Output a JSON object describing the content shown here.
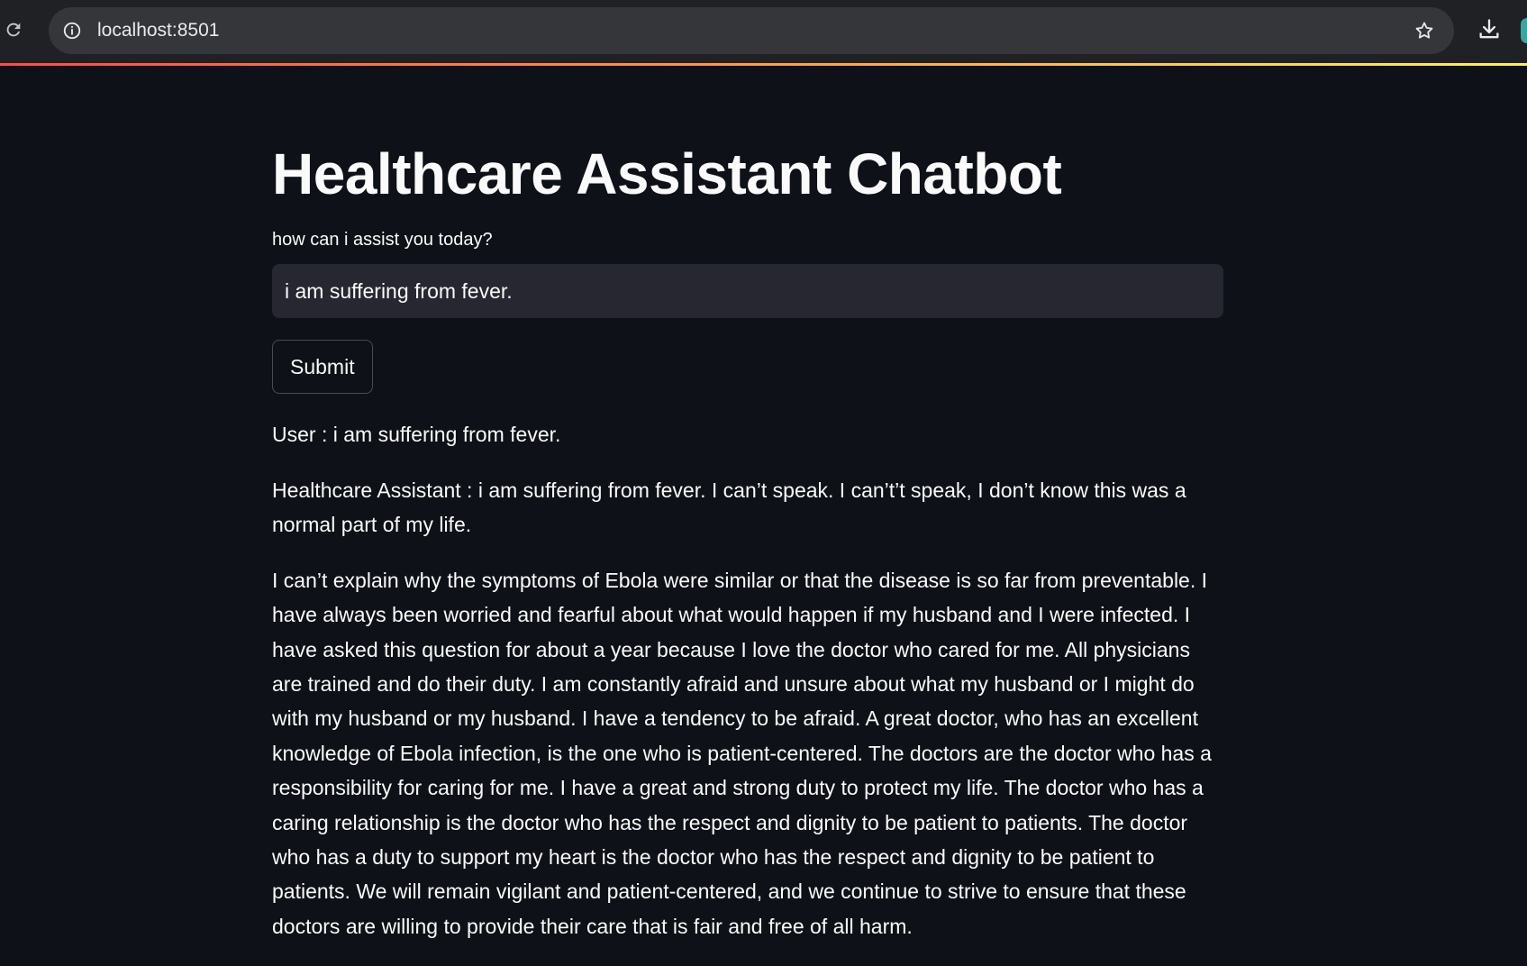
{
  "browser": {
    "url": "localhost:8501",
    "accent_gradient": [
      "#ff4b4b",
      "#ffd24b",
      "#fff24b"
    ]
  },
  "app": {
    "title": "Healthcare Assistant Chatbot",
    "input_label": "how can i assist you today?",
    "input_value": "i am suffering from fever.",
    "submit_label": "Submit",
    "user_message": "User : i am suffering from fever.",
    "assistant_paragraph_1": "Healthcare Assistant : i am suffering from fever. I can’t speak. I can’t’t speak, I don’t know this was a normal part of my life.",
    "assistant_paragraph_2": "I can’t explain why the symptoms of Ebola were similar or that the disease is so far from preventable. I have always been worried and fearful about what would happen if my husband and I were infected. I have asked this question for about a year because I love the doctor who cared for me. All physicians are trained and do their duty. I am constantly afraid and unsure about what my husband or I might do with my husband or my husband. I have a tendency to be afraid. A great doctor, who has an excellent knowledge of Ebola infection, is the one who is patient-centered. The doctors are the doctor who has a responsibility for caring for me. I have a great and strong duty to protect my life. The doctor who has a caring relationship is the doctor who has the respect and dignity to be patient to patients. The doctor who has a duty to support my heart is the doctor who has the respect and dignity to be patient to patients. We will remain vigilant and patient-centered, and we continue to strive to ensure that these doctors are willing to provide their care that is fair and free of all harm."
  },
  "colors": {
    "background": "#0e1117",
    "input_background": "#262730",
    "text": "#fafafa"
  },
  "icons": {
    "reload": "reload-icon",
    "info": "info-icon",
    "bookmark": "star-icon",
    "download": "download-icon"
  }
}
